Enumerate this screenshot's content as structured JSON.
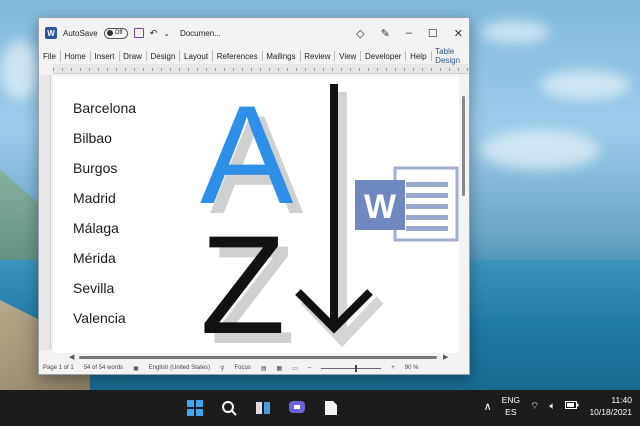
{
  "title_bar": {
    "autosave_label": "AutoSave",
    "autosave_state": "Off",
    "document_name": "Documen..."
  },
  "menu": [
    "File",
    "Home",
    "Insert",
    "Draw",
    "Design",
    "Layout",
    "References",
    "Mailings",
    "Review",
    "View",
    "Developer",
    "Help",
    "Table Design"
  ],
  "document": {
    "cities": [
      "Barcelona",
      "Bilbao",
      "Burgos",
      "Madrid",
      "Málaga",
      "Mérida",
      "Sevilla",
      "Valencia"
    ]
  },
  "overlay": {
    "letter_a": "A",
    "letter_z": "Z",
    "word_letter": "W"
  },
  "status_bar": {
    "page": "Page 1 of 1",
    "words": "54 of 54 words",
    "language": "English (United States)",
    "focus": "Focus",
    "zoom": "90 %"
  },
  "taskbar": {
    "lang_line1": "ENG",
    "lang_line2": "ES",
    "time": "11:40",
    "date": "10/18/2021"
  },
  "colors": {
    "word_blue": "#2b579a",
    "a_blue": "#2e8fe8",
    "taskbar": "#1c1c1c"
  }
}
